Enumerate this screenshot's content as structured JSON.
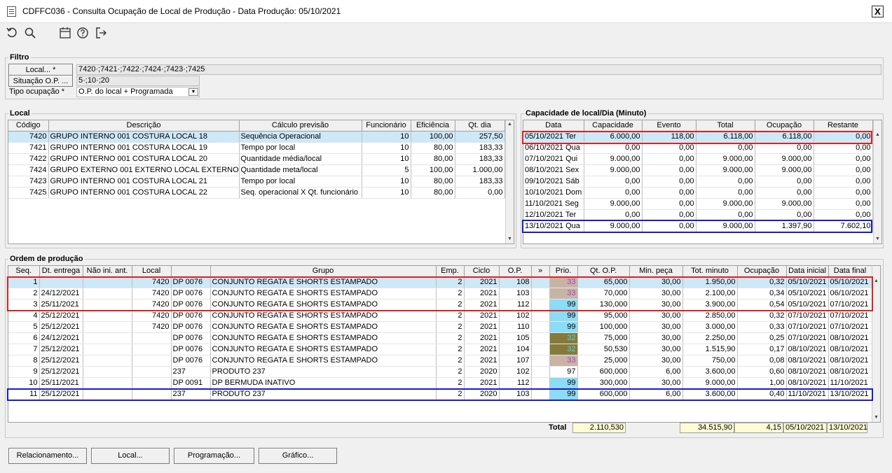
{
  "window": {
    "title": "CDFFC036 - Consulta Ocupação de Local de Produção - Data Produção: 05/10/2021",
    "close_label": "X"
  },
  "toolbar": {
    "icons": [
      "undo-icon",
      "search-icon",
      "calendar-icon",
      "help-icon",
      "exit-icon"
    ]
  },
  "filtro": {
    "title": "Filtro",
    "local_button": "Local... *",
    "local_value": "7420·;7421·;7422·;7424·;7423·;7425",
    "situacao_button": "Situação O.P. ...",
    "situacao_value": "5·;10·;20",
    "tipo_label": "Tipo ocupação *",
    "tipo_value": "O.P. do local + Programada"
  },
  "local": {
    "title": "Local",
    "columns": [
      "Código",
      "Descrição",
      "Cálculo previsão",
      "Funcionário",
      "Eficiência",
      "Qt. dia"
    ],
    "rows": [
      [
        "7420",
        "GRUPO INTERNO 001 COSTURA LOCAL 18",
        "Sequência Operacional",
        "10",
        "100,00",
        "257,50"
      ],
      [
        "7421",
        "GRUPO INTERNO 001 COSTURA LOCAL 19",
        "Tempo por local",
        "10",
        "80,00",
        "183,33"
      ],
      [
        "7422",
        "GRUPO INTERNO 001 COSTURA LOCAL 20",
        "Quantidade média/local",
        "10",
        "80,00",
        "183,33"
      ],
      [
        "7424",
        "GRUPO EXTERNO 001 EXTERNO LOCAL EXTERNO",
        "Quantidade meta/local",
        "5",
        "100,00",
        "1.000,00"
      ],
      [
        "7423",
        "GRUPO INTERNO 001 COSTURA LOCAL 21",
        "Tempo por local",
        "10",
        "80,00",
        "183,33"
      ],
      [
        "7425",
        "GRUPO INTERNO 001 COSTURA LOCAL 22",
        "Seq. operacional X Qt. funcionário",
        "10",
        "80,00",
        "0,00"
      ]
    ]
  },
  "capacidade": {
    "title": "Capacidade de local/Dia (Minuto)",
    "columns": [
      "Data",
      "Capacidade",
      "Evento",
      "Total",
      "Ocupação",
      "Restante"
    ],
    "rows": [
      [
        "05/10/2021 Ter",
        "6.000,00",
        "118,00",
        "6.118,00",
        "6.118,00",
        "0,00"
      ],
      [
        "06/10/2021 Qua",
        "0,00",
        "0,00",
        "0,00",
        "0,00",
        "0,00"
      ],
      [
        "07/10/2021 Qui",
        "9.000,00",
        "0,00",
        "9.000,00",
        "9.000,00",
        "0,00"
      ],
      [
        "08/10/2021 Sex",
        "9.000,00",
        "0,00",
        "9.000,00",
        "9.000,00",
        "0,00"
      ],
      [
        "09/10/2021 Sáb",
        "0,00",
        "0,00",
        "0,00",
        "0,00",
        "0,00"
      ],
      [
        "10/10/2021 Dom",
        "0,00",
        "0,00",
        "0,00",
        "0,00",
        "0,00"
      ],
      [
        "11/10/2021 Seg",
        "9.000,00",
        "0,00",
        "9.000,00",
        "9.000,00",
        "0,00"
      ],
      [
        "12/10/2021 Ter",
        "0,00",
        "0,00",
        "0,00",
        "0,00",
        "0,00"
      ],
      [
        "13/10/2021 Qua",
        "9.000,00",
        "0,00",
        "9.000,00",
        "1.397,90",
        "7.602,10"
      ]
    ]
  },
  "ordem": {
    "title": "Ordem de produção",
    "columns": [
      "Seq.",
      "Dt. entrega",
      "Não ini. ant.",
      "Local",
      "",
      "Grupo",
      "Emp.",
      "Ciclo",
      "O.P.",
      "»",
      "Prio.",
      "Qt. O.P.",
      "Min. peça",
      "Tot. minuto",
      "Ocupação",
      "Data inicial",
      "Data final"
    ],
    "rows": [
      [
        "1",
        "",
        "",
        "7420",
        "DP 0076",
        "CONJUNTO REGATA E SHORTS ESTAMPADO",
        "2",
        "2021",
        "108",
        "",
        "33",
        "65,000",
        "30,00",
        "1.950,00",
        "0,32",
        "05/10/2021",
        "05/10/2021"
      ],
      [
        "2",
        "24/12/2021",
        "",
        "7420",
        "DP 0076",
        "CONJUNTO REGATA E SHORTS ESTAMPADO",
        "2",
        "2021",
        "103",
        "",
        "33",
        "70,000",
        "30,00",
        "2.100,00",
        "0,34",
        "05/10/2021",
        "06/10/2021"
      ],
      [
        "3",
        "25/11/2021",
        "",
        "7420",
        "DP 0076",
        "CONJUNTO REGATA E SHORTS ESTAMPADO",
        "2",
        "2021",
        "112",
        "",
        "99",
        "130,000",
        "30,00",
        "3.900,00",
        "0,54",
        "05/10/2021",
        "07/10/2021"
      ],
      [
        "4",
        "25/12/2021",
        "",
        "7420",
        "DP 0076",
        "CONJUNTO REGATA E SHORTS ESTAMPADO",
        "2",
        "2021",
        "102",
        "",
        "99",
        "95,000",
        "30,00",
        "2.850,00",
        "0,32",
        "07/10/2021",
        "07/10/2021"
      ],
      [
        "5",
        "25/12/2021",
        "",
        "7420",
        "DP 0076",
        "CONJUNTO REGATA E SHORTS ESTAMPADO",
        "2",
        "2021",
        "110",
        "",
        "99",
        "100,000",
        "30,00",
        "3.000,00",
        "0,33",
        "07/10/2021",
        "07/10/2021"
      ],
      [
        "6",
        "24/12/2021",
        "",
        "",
        "DP 0076",
        "CONJUNTO REGATA E SHORTS ESTAMPADO",
        "2",
        "2021",
        "105",
        "",
        "32",
        "75,000",
        "30,00",
        "2.250,00",
        "0,25",
        "07/10/2021",
        "08/10/2021"
      ],
      [
        "7",
        "25/12/2021",
        "",
        "",
        "DP 0076",
        "CONJUNTO REGATA E SHORTS ESTAMPADO",
        "2",
        "2021",
        "104",
        "",
        "32",
        "50,530",
        "30,00",
        "1.515,90",
        "0,17",
        "08/10/2021",
        "08/10/2021"
      ],
      [
        "8",
        "25/12/2021",
        "",
        "",
        "DP 0076",
        "CONJUNTO REGATA E SHORTS ESTAMPADO",
        "2",
        "2021",
        "107",
        "",
        "33",
        "25,000",
        "30,00",
        "750,00",
        "0,08",
        "08/10/2021",
        "08/10/2021"
      ],
      [
        "9",
        "25/12/2021",
        "",
        "",
        "237",
        "PRODUTO 237",
        "2",
        "2020",
        "102",
        "",
        "97",
        "600,000",
        "6,00",
        "3.600,00",
        "0,60",
        "08/10/2021",
        "08/10/2021"
      ],
      [
        "10",
        "25/11/2021",
        "",
        "",
        "DP 0091",
        "DP BERMUDA INATIVO",
        "2",
        "2021",
        "112",
        "",
        "99",
        "300,000",
        "30,00",
        "9.000,00",
        "1,00",
        "08/10/2021",
        "11/10/2021"
      ],
      [
        "11",
        "25/12/2021",
        "",
        "",
        "237",
        "PRODUTO 237",
        "2",
        "2020",
        "103",
        "",
        "99",
        "600,000",
        "6,00",
        "3.600,00",
        "0,40",
        "11/10/2021",
        "13/10/2021"
      ]
    ],
    "prio_colors": {
      "33": "#c8b4a6",
      "99": "#8ddcf5",
      "32": "#857a3a",
      "97": "#ffffff"
    },
    "prio_text_colors": {
      "33": "#a040c0",
      "99": "#000000",
      "32": "#4bd7e6",
      "97": "#000000"
    },
    "total_label": "Total",
    "total_qt_op": "2.110,530",
    "total_minuto": "34.515,90",
    "total_ocupacao": "4,15",
    "total_data_inicial": "05/10/2021",
    "total_data_final": "13/10/2021"
  },
  "buttons": {
    "relacionamento": "Relacionamento...",
    "local": "Local...",
    "programacao": "Programação...",
    "grafico": "Gráfico..."
  },
  "colors": {
    "highlight_red": "#e02020",
    "highlight_blue": "#1a1ad0",
    "selected_row": "#cde8f7",
    "total_bg": "#fffbd6"
  }
}
